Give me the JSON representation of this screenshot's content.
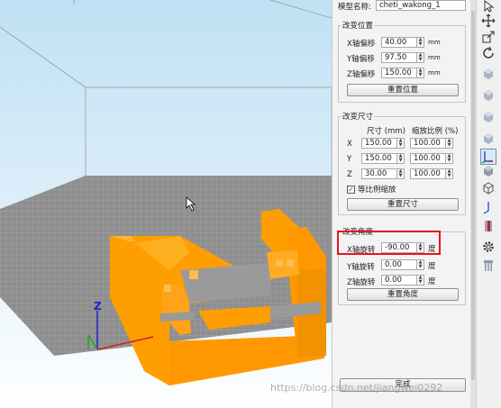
{
  "model": {
    "name_label": "模型名称:",
    "name_value": "cheti_wakong_1"
  },
  "position": {
    "title": "改变位置",
    "x_label": "X轴偏移",
    "x_value": "40.00",
    "y_label": "Y轴偏移",
    "y_value": "97.50",
    "z_label": "Z轴偏移",
    "z_value": "150.00",
    "unit": "mm",
    "reset_label": "重置位置"
  },
  "size": {
    "title": "改变尺寸",
    "col_size": "尺寸 (mm)",
    "col_scale": "缩放比例 (%)",
    "rows": [
      {
        "axis": "X",
        "size": "150.00",
        "scale": "100.00"
      },
      {
        "axis": "Y",
        "size": "150.00",
        "scale": "100.00"
      },
      {
        "axis": "Z",
        "size": "30.00",
        "scale": "100.00"
      }
    ],
    "uniform_label": "等比例缩放",
    "uniform_checked": true,
    "reset_label": "重置尺寸"
  },
  "rotation": {
    "title": "改变角度",
    "x_label": "X轴旋转",
    "x_value": "-90.00",
    "y_label": "Y轴旋转",
    "y_value": "0.00",
    "z_label": "Z轴旋转",
    "z_value": "0.00",
    "unit": "度",
    "reset_label": "重置角度",
    "highlight_color": "#e8141e"
  },
  "done_label": "完成",
  "viewport": {
    "axis_z_label": "Z",
    "model_color": "#ff9e00",
    "bed_color": "#8c8c8c",
    "bg_top": "#c0e2f4",
    "bg_bottom": "#ffffff"
  },
  "toolbar": {
    "icons": [
      "select-arrow-icon",
      "move-icon",
      "scale-icon",
      "rotate-icon",
      "cube-view-icon",
      "cube-view-icon",
      "cube-view-icon",
      "cube-view-icon",
      "cube-view-icon",
      "axis-view-icon",
      "solid-view-icon",
      "wireframe-view-icon",
      "axis-line-icon",
      "cut-icon",
      "gear-icon",
      "support-icon"
    ]
  },
  "watermark": "https://blog.csdn.net/jiangwei0292"
}
